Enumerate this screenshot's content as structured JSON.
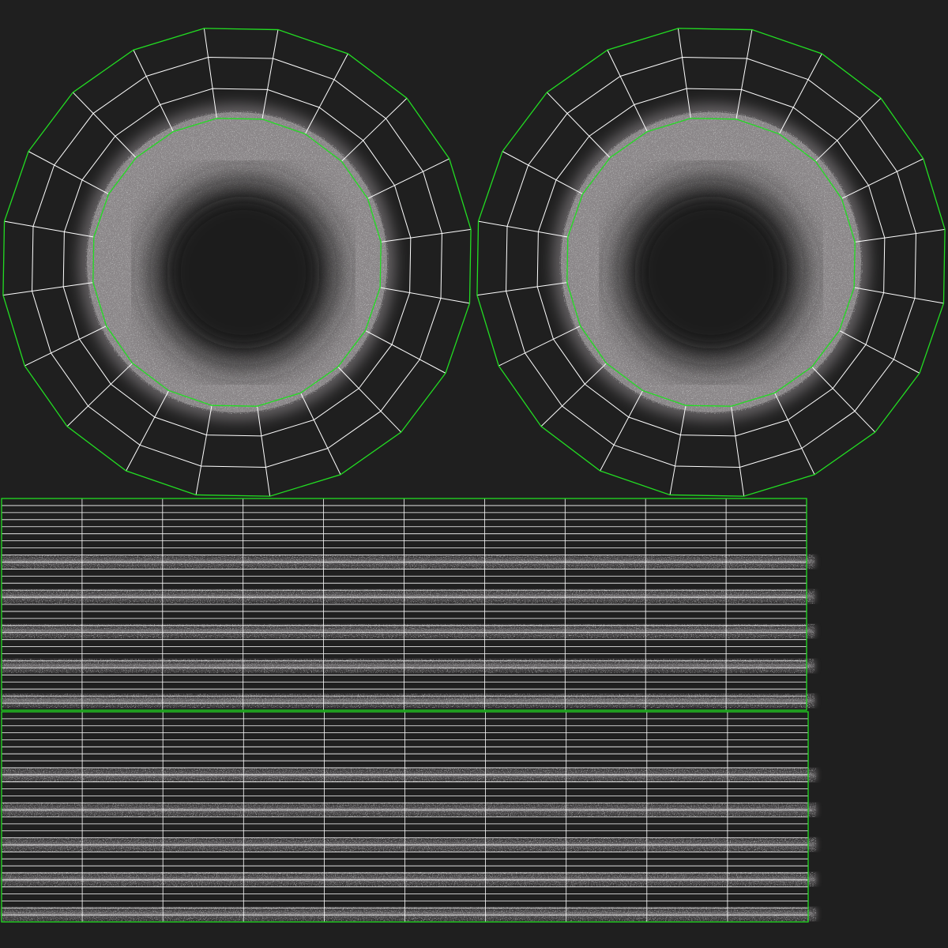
{
  "colors": {
    "background": "#1f1f1f",
    "seam": "#22dd22",
    "wire": "#ffffff",
    "texture_light": "#a9a6a8",
    "texture_mid": "#6e6b6d",
    "texture_dark": "#1c1c1c"
  },
  "uv_islands": {
    "discs": [
      {
        "id": "disc-left",
        "radial_segments": 20,
        "ring_levels": 3,
        "rotation_deg": 10
      },
      {
        "id": "disc-right",
        "radial_segments": 20,
        "ring_levels": 3,
        "rotation_deg": 10
      }
    ],
    "strips": [
      {
        "id": "strip-top",
        "columns": 10,
        "rows": 30
      },
      {
        "id": "strip-bottom",
        "columns": 10,
        "rows": 30
      }
    ]
  }
}
